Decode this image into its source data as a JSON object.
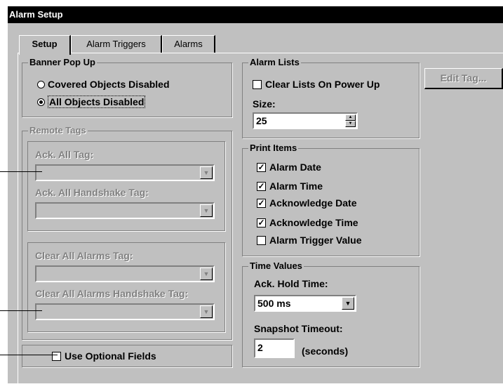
{
  "window": {
    "title": "Alarm Setup"
  },
  "tabs": [
    {
      "label": "Setup",
      "active": true
    },
    {
      "label": "Alarm Triggers",
      "active": false
    },
    {
      "label": "Alarms",
      "active": false
    }
  ],
  "banner_popup": {
    "title": "Banner Pop Up",
    "options": [
      {
        "label": "Covered Objects Disabled",
        "selected": false
      },
      {
        "label": "All Objects Disabled",
        "selected": true
      }
    ]
  },
  "remote_tags": {
    "title": "Remote Tags",
    "ack_all_tag_label": "Ack. All Tag:",
    "ack_all_handshake_label": "Ack. All Handshake Tag:",
    "clear_all_alarms_label": "Clear All Alarms Tag:",
    "clear_all_handshake_label": "Clear All Alarms Handshake Tag:"
  },
  "optional_fields": {
    "label": "Use Optional Fields",
    "checked": false
  },
  "alarm_lists": {
    "title": "Alarm Lists",
    "clear_label": "Clear Lists On Power Up",
    "clear_checked": false,
    "size_label": "Size:",
    "size_value": "25"
  },
  "edit_tag_button": "Edit Tag...",
  "print_items": {
    "title": "Print Items",
    "items": [
      {
        "label": "Alarm Date",
        "checked": true
      },
      {
        "label": "Alarm Time",
        "checked": true
      },
      {
        "label": "Acknowledge Date",
        "checked": true
      },
      {
        "label": "Acknowledge Time",
        "checked": true
      },
      {
        "label": "Alarm Trigger Value",
        "checked": false
      }
    ]
  },
  "time_values": {
    "title": "Time Values",
    "ack_hold_label": "Ack. Hold Time:",
    "ack_hold_value": "500 ms",
    "snapshot_label": "Snapshot Timeout:",
    "snapshot_value": "2",
    "snapshot_unit": "(seconds)"
  }
}
